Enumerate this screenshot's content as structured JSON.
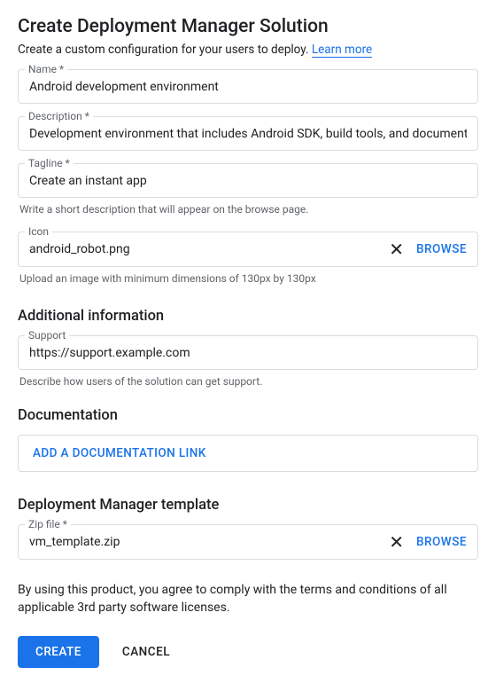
{
  "header": {
    "title": "Create Deployment Manager Solution",
    "subtitle_prefix": "Create a custom configuration for your users to deploy. ",
    "learn_more": "Learn more"
  },
  "fields": {
    "name": {
      "label": "Name *",
      "value": "Android development environment"
    },
    "description": {
      "label": "Description *",
      "value": "Development environment that includes Android SDK, build tools, and documentation."
    },
    "tagline": {
      "label": "Tagline *",
      "value": "Create an instant app",
      "helper": "Write a short description that will appear on the browse page."
    },
    "icon": {
      "label": "Icon",
      "filename": "android_robot.png",
      "browse": "BROWSE",
      "helper": "Upload an image with minimum dimensions of 130px by 130px"
    }
  },
  "additional": {
    "title": "Additional information",
    "support": {
      "label": "Support",
      "value": "https://support.example.com",
      "helper": "Describe how users of the solution can get support."
    }
  },
  "documentation": {
    "title": "Documentation",
    "add_button": "ADD A DOCUMENTATION LINK"
  },
  "template": {
    "title": "Deployment Manager template",
    "zip": {
      "label": "Zip file *",
      "filename": "vm_template.zip",
      "browse": "BROWSE"
    }
  },
  "terms": "By using this product, you agree to comply with the terms and conditions of all applicable 3rd party software licenses.",
  "actions": {
    "create": "CREATE",
    "cancel": "CANCEL"
  }
}
